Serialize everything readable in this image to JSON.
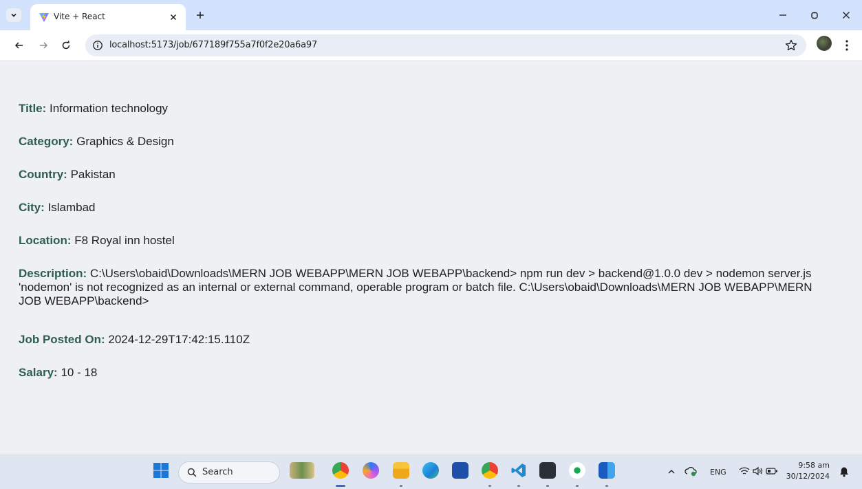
{
  "browser": {
    "tab_title": "Vite + React",
    "url": "localhost:5173/job/677189f755a7f0f2e20a6a97"
  },
  "job": {
    "title": {
      "label": "Title:",
      "value": "Information technology"
    },
    "category": {
      "label": "Category:",
      "value": "Graphics & Design"
    },
    "country": {
      "label": "Country:",
      "value": "Pakistan"
    },
    "city": {
      "label": "City:",
      "value": "Islambad"
    },
    "location": {
      "label": "Location:",
      "value": "F8 Royal inn hostel"
    },
    "description": {
      "label": "Description:",
      "value": "C:\\Users\\obaid\\Downloads\\MERN JOB WEBAPP\\MERN JOB WEBAPP\\backend> npm run dev > backend@1.0.0 dev > nodemon server.js 'nodemon' is not recognized as an internal or external command, operable program or batch file. C:\\Users\\obaid\\Downloads\\MERN JOB WEBAPP\\MERN JOB WEBAPP\\backend>"
    },
    "posted_on": {
      "label": "Job Posted On:",
      "value": "2024-12-29T17:42:15.110Z"
    },
    "salary": {
      "label": "Salary:",
      "value": "10 - 18"
    }
  },
  "taskbar": {
    "search_label": "Search",
    "language": "ENG",
    "time": "9:58 am",
    "date": "30/12/2024"
  },
  "colors": {
    "label_green": "#2f5d50",
    "tabbar_bg": "#d3e3fd",
    "page_bg": "#eef0f3"
  }
}
